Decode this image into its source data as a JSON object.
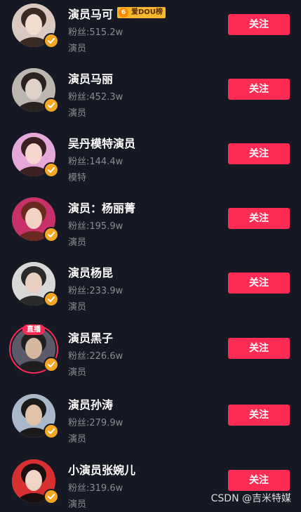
{
  "follow_label": "关注",
  "fans_label": "粉丝:",
  "live_badge": "直播",
  "aidou_badge": {
    "icon": "coin-icon",
    "text": "爱DOU榜",
    "coin_glyph": "6"
  },
  "watermark": "CSDN @吉米特媒",
  "colors": {
    "background": "#161823",
    "accent": "#fe2c55",
    "verified": "#f5a623",
    "muted": "#8a8b91"
  },
  "users": [
    {
      "name": "演员马可",
      "fans": "515.2w",
      "tag": "演员",
      "verified": true,
      "live": false,
      "has_aidou": true
    },
    {
      "name": "演员马丽",
      "fans": "452.3w",
      "tag": "演员",
      "verified": true,
      "live": false,
      "has_aidou": false
    },
    {
      "name": "吴丹模特演员",
      "fans": "144.4w",
      "tag": "模特",
      "verified": true,
      "live": false,
      "has_aidou": false
    },
    {
      "name": "演员：杨丽菁",
      "fans": "195.9w",
      "tag": "演员",
      "verified": true,
      "live": false,
      "has_aidou": false
    },
    {
      "name": "演员杨昆",
      "fans": "233.9w",
      "tag": "演员",
      "verified": true,
      "live": false,
      "has_aidou": false
    },
    {
      "name": "演员黑子",
      "fans": "226.6w",
      "tag": "演员",
      "verified": true,
      "live": true,
      "has_aidou": false
    },
    {
      "name": "演员孙涛",
      "fans": "279.9w",
      "tag": "演员",
      "verified": true,
      "live": false,
      "has_aidou": false
    },
    {
      "name": "小演员张婉儿",
      "fans": "319.6w",
      "tag": "演员",
      "verified": true,
      "live": false,
      "has_aidou": false
    }
  ]
}
